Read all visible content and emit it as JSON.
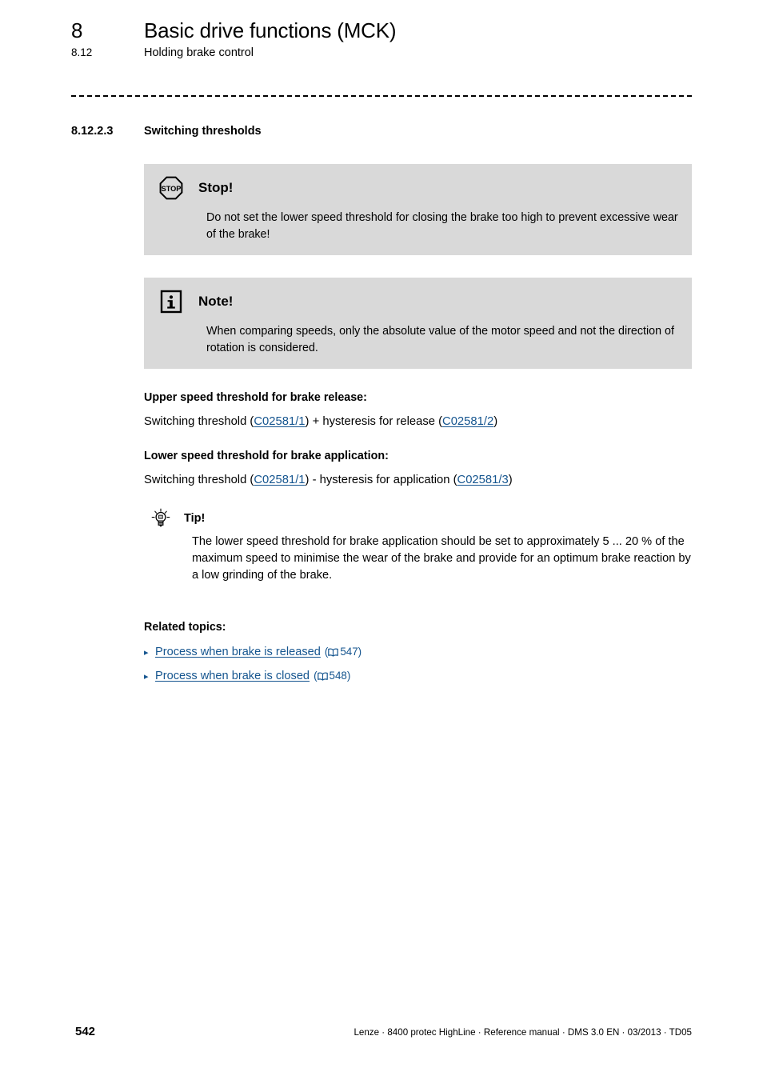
{
  "header": {
    "chapter_number": "8",
    "chapter_title": "Basic drive functions (MCK)",
    "section_number": "8.12",
    "section_title": "Holding brake control"
  },
  "subsection": {
    "number": "8.12.2.3",
    "title": "Switching thresholds"
  },
  "callouts": [
    {
      "icon": "stop-icon",
      "icon_label": "STOP",
      "title": "Stop!",
      "body": "Do not set the lower speed threshold for closing the brake too high to prevent excessive wear of the brake!"
    },
    {
      "icon": "info-icon",
      "icon_label": "i",
      "title": "Note!",
      "body": "When comparing speeds, only the absolute value of the motor speed and not the direction of rotation is considered."
    }
  ],
  "thresholds": {
    "upper": {
      "lead": "Upper speed threshold for brake release:",
      "prefix": "Switching threshold (",
      "link1": "C02581/1",
      "middle": ") + hysteresis for release (",
      "link2": "C02581/2",
      "suffix": ")"
    },
    "lower": {
      "lead": "Lower speed threshold for brake application:",
      "prefix": "Switching threshold (",
      "link1": "C02581/1",
      "middle": ") - hysteresis for application (",
      "link2": "C02581/3",
      "suffix": ")"
    }
  },
  "tip": {
    "icon": "lightbulb-icon",
    "title": "Tip!",
    "body": "The lower speed threshold for brake application should be set to approximately 5 ... 20 % of the maximum speed to minimise the wear of the brake and provide for an optimum brake reaction by a low grinding of the brake."
  },
  "related": {
    "title": "Related topics:",
    "items": [
      {
        "bullet": "▸",
        "label": "Process when brake is released",
        "page_prefix": "(",
        "page": "547",
        "page_suffix": ")"
      },
      {
        "bullet": "▸",
        "label": "Process when brake is closed",
        "page_prefix": "(",
        "page": "548",
        "page_suffix": ")"
      }
    ]
  },
  "footer": {
    "page_number": "542",
    "imprint": "Lenze · 8400 protec HighLine · Reference manual · DMS 3.0 EN · 03/2013 · TD05"
  },
  "colors": {
    "link": "#15558f",
    "callout_bg": "#d9d9d9"
  }
}
